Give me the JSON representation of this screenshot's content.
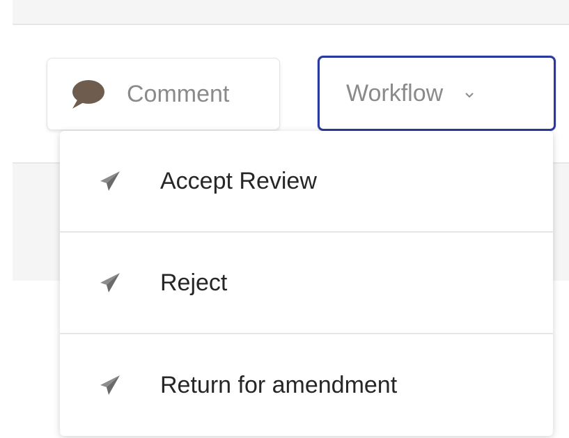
{
  "toolbar": {
    "comment_label": "Comment",
    "comment_icon": "speech-bubble-icon",
    "workflow_label": "Workflow",
    "workflow_icon": "chevron-down-icon"
  },
  "workflow_menu": {
    "items": [
      {
        "label": "Accept Review",
        "icon": "paper-plane-icon"
      },
      {
        "label": "Reject",
        "icon": "paper-plane-icon"
      },
      {
        "label": "Return for amendment",
        "icon": "paper-plane-icon"
      }
    ]
  },
  "colors": {
    "accent_border": "#2a3a9c",
    "comment_icon": "#6e5d4e",
    "menu_icon": "#8c8c8c",
    "muted_text": "#8a8a8a",
    "menu_text": "#262626"
  }
}
